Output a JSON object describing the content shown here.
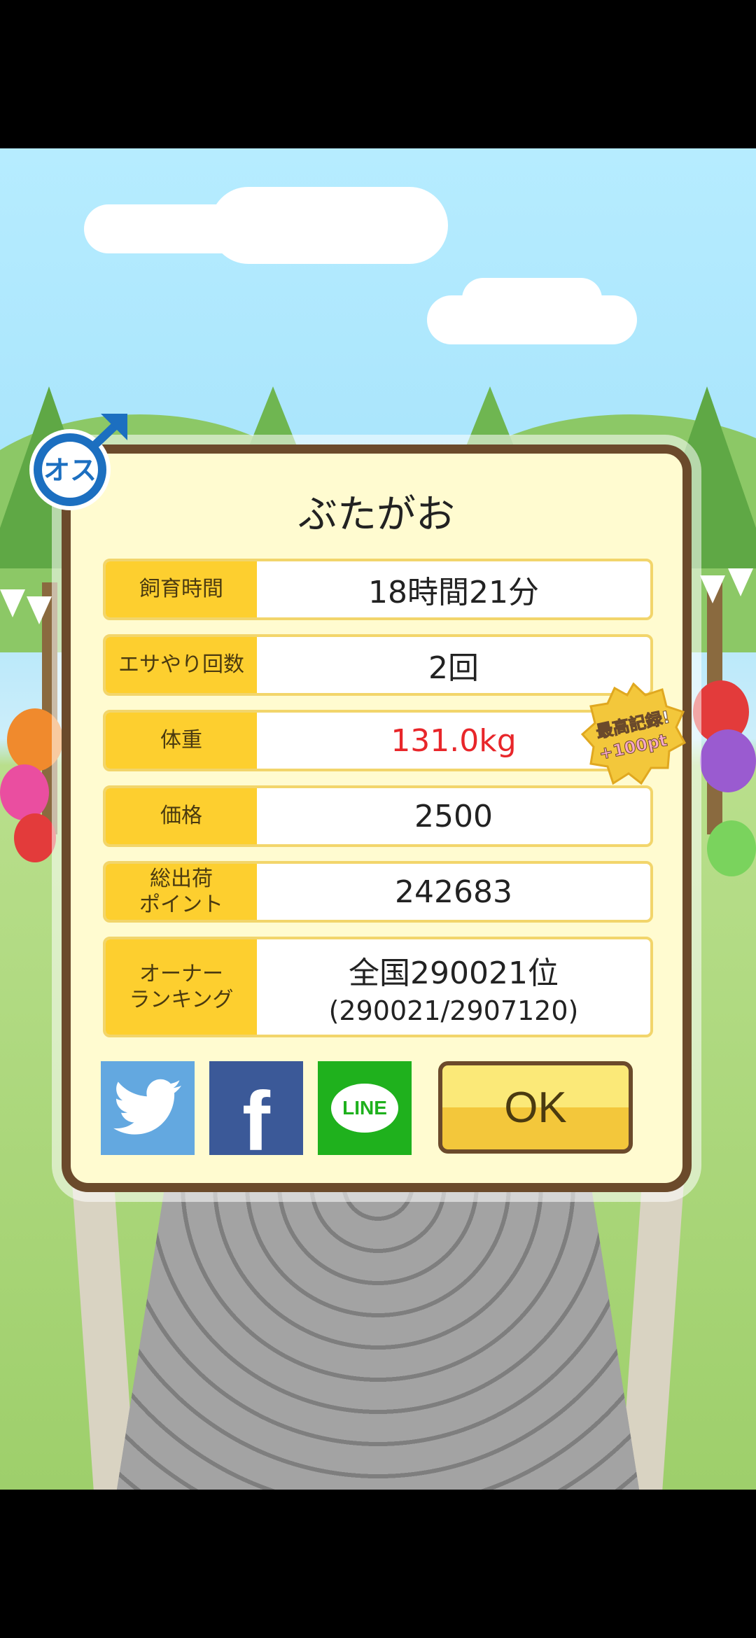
{
  "dialog": {
    "title": "ぶたがお",
    "rows": [
      {
        "label": "飼育時間",
        "value": "18時間21分"
      },
      {
        "label": "エサやり回数",
        "value": "2回"
      },
      {
        "label": "体重",
        "value": "131.0kg"
      },
      {
        "label": "価格",
        "value": "2500"
      },
      {
        "label": "総出荷\nポイント",
        "value": "242683"
      },
      {
        "label": "オーナー\nランキング",
        "value": "全国290021位",
        "sub": "(290021/2907120)"
      }
    ],
    "ok_label": "OK"
  },
  "social": {
    "twitter_icon": "twitter-bird-icon",
    "facebook_glyph": "f",
    "line_label": "LINE"
  },
  "badges": {
    "gender_label": "オス",
    "record_line1": "最高記録!",
    "record_line2": "+100pt"
  },
  "colors": {
    "weight_value": "#e8262a",
    "label_bg": "#fdcf2f",
    "dialog_border": "#6b4a2b"
  }
}
